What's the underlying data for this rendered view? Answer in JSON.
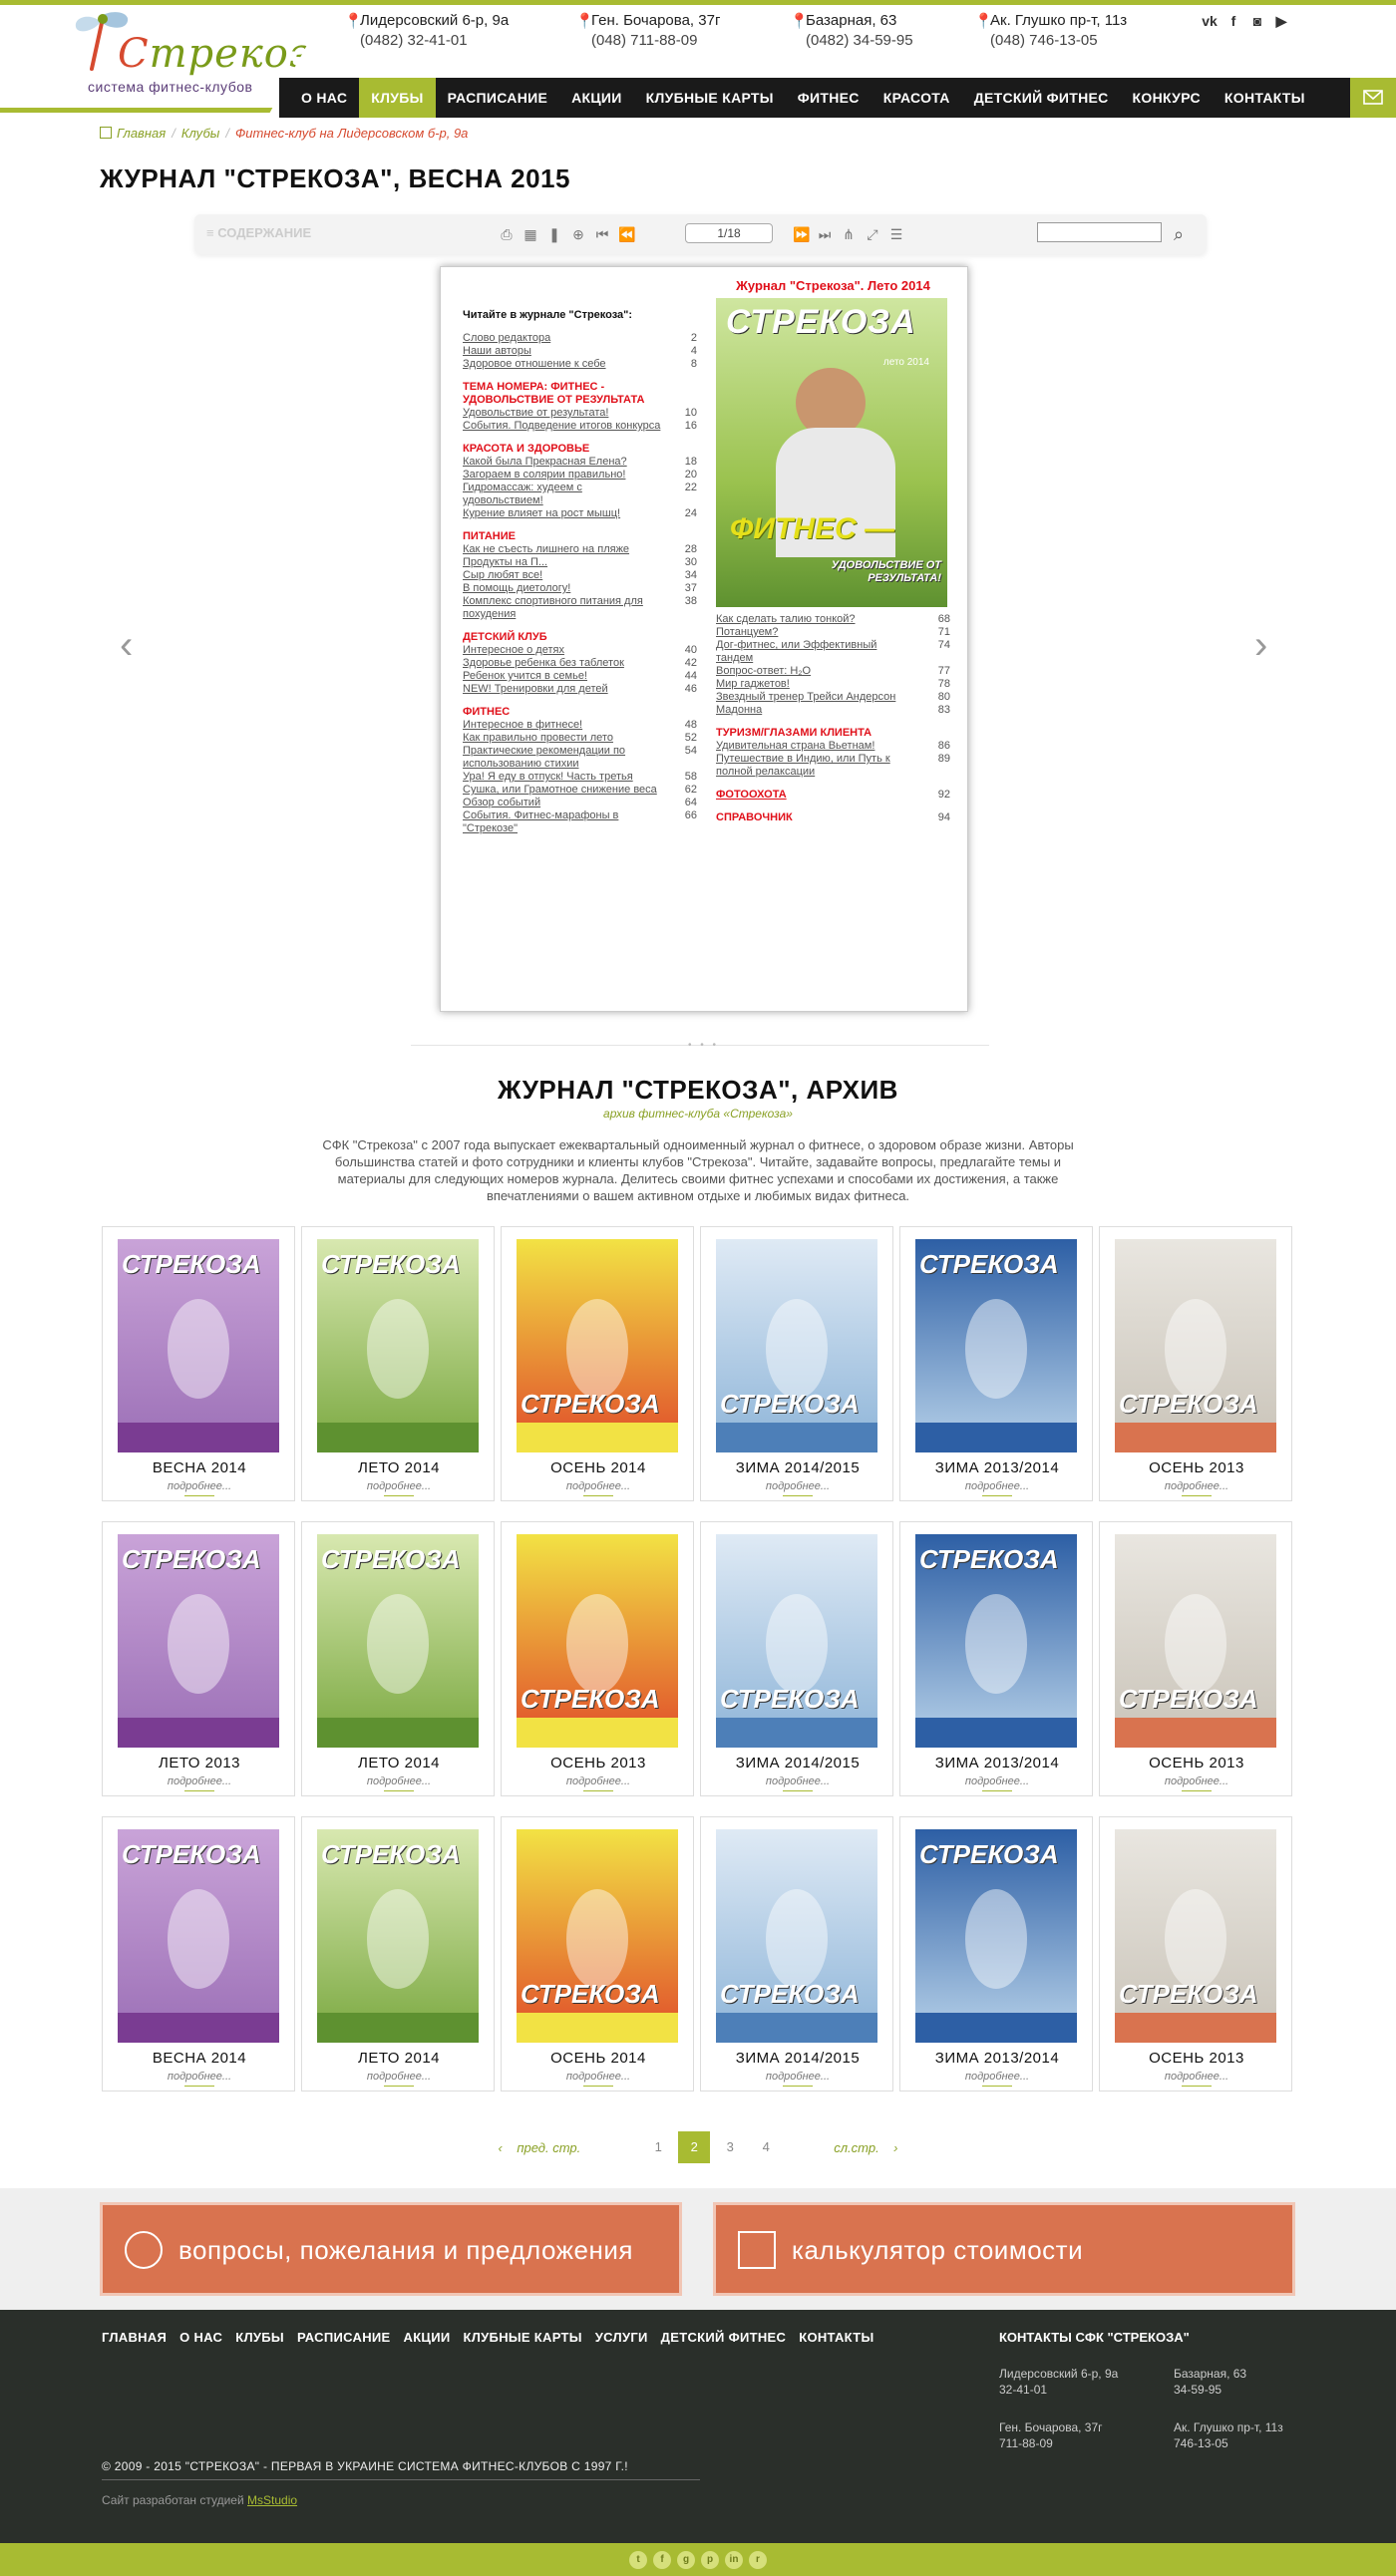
{
  "logo": {
    "brand": "Стрекоза",
    "subtitle": "система фитнес-клубов"
  },
  "contacts": [
    {
      "address": "Лидерсовский 6-р, 9а",
      "phone": "(0482) 32-41-01"
    },
    {
      "address": "Ген. Бочарова, 37г",
      "phone": "(048) 711-88-09"
    },
    {
      "address": "Базарная, 63",
      "phone": "(0482) 34-59-95"
    },
    {
      "address": "Ак. Глушко пр-т, 11з",
      "phone": "(048) 746-13-05"
    }
  ],
  "social_icons": [
    "vk-icon",
    "facebook-icon",
    "instagram-icon",
    "youtube-icon"
  ],
  "nav": [
    "О НАС",
    "КЛУБЫ",
    "РАСПИСАНИЕ",
    "АКЦИИ",
    "КЛУБНЫЕ КАРТЫ",
    "ФИТНЕС",
    "КРАСОТА",
    "ДЕТСКИЙ ФИТНЕС",
    "КОНКУРС",
    "КОНТАКТЫ"
  ],
  "nav_active": "КЛУБЫ",
  "breadcrumb": [
    "Главная",
    "Клубы",
    "Фитнес-клуб на Лидерсовском б-р, 9а"
  ],
  "page_title": "ЖУРНАЛ \"СТРЕКОЗА\", ВЕСНА 2015",
  "viewer": {
    "contents_label": "СОДЕРЖАНИЕ",
    "page_indicator": "1/18"
  },
  "magazine": {
    "heading": "Читайте в журнале \"Стрекоза\":",
    "right_title": "Журнал \"Стрекоза\". Лето 2014",
    "cover_brand": "СТРЕКОЗА",
    "cover_season": "лето 2014",
    "cover_word": "ФИТНЕС —",
    "cover_slogan": "УДОВОЛЬСТВИЕ ОТ РЕЗУЛЬТАТА!",
    "left": [
      {
        "t": "Слово редактора",
        "p": "2"
      },
      {
        "t": "Наши авторы",
        "p": "4"
      },
      {
        "t": "Здоровое отношение к себе",
        "p": "8"
      },
      {
        "sec": "ТЕМА НОМЕРА: ФИТНЕС - УДОВОЛЬСТВИЕ ОТ РЕЗУЛЬТАТА"
      },
      {
        "t": "Удовольствие от результата!",
        "p": "10"
      },
      {
        "t": "События. Подведение итогов конкурса",
        "p": "16"
      },
      {
        "sec": "КРАСОТА И ЗДОРОВЬЕ"
      },
      {
        "t": "Какой была Прекрасная Елена?",
        "p": "18"
      },
      {
        "t": "Загораем в солярии правильно!",
        "p": "20"
      },
      {
        "t": "Гидромассаж: худеем с удовольствием!",
        "p": "22"
      },
      {
        "t": "Курение влияет на рост мышц!",
        "p": "24"
      },
      {
        "sec": "ПИТАНИЕ"
      },
      {
        "t": "Как не съесть лишнего на пляже",
        "p": "28"
      },
      {
        "t": "Продукты на П...",
        "p": "30"
      },
      {
        "t": "Сыр любят все!",
        "p": "34"
      },
      {
        "t": "В помощь диетологу!",
        "p": "37"
      },
      {
        "t": "Комплекс спортивного питания для похудения",
        "p": "38"
      },
      {
        "sec": "ДЕТСКИЙ КЛУБ"
      },
      {
        "t": "Интересное о детях",
        "p": "40"
      },
      {
        "t": "Здоровье ребенка без таблеток",
        "p": "42"
      },
      {
        "t": "Ребенок учится в семье!",
        "p": "44"
      },
      {
        "t": "NEW! Тренировки для детей",
        "p": "46"
      },
      {
        "sec": "ФИТНЕС"
      },
      {
        "t": "Интересное в фитнесе!",
        "p": "48"
      },
      {
        "t": "Как правильно провести лето",
        "p": "52"
      },
      {
        "t": "Практические рекомендации по использованию стихии",
        "p": "54"
      },
      {
        "t": "Ура! Я еду в отпуск! Часть третья",
        "p": "58"
      },
      {
        "t": "Сушка, или Грамотное снижение веса",
        "p": "62"
      },
      {
        "t": "Обзор событий",
        "p": "64"
      },
      {
        "t": "События. Фитнес-марафоны в \"Стрекозе\"",
        "p": "66"
      }
    ],
    "right": [
      {
        "t": "Как сделать талию тонкой?",
        "p": "68"
      },
      {
        "t": "Потанцуем?",
        "p": "71"
      },
      {
        "t": "Дог-фитнес, или Эффективный тандем",
        "p": "74"
      },
      {
        "t": "Вопрос-ответ: H₂O",
        "p": "77"
      },
      {
        "t": "Мир гаджетов!",
        "p": "78"
      },
      {
        "t": "Звездный тренер Трейси Андерсон",
        "p": "80"
      },
      {
        "t": "Мадонна",
        "p": "83"
      },
      {
        "sec": "ТУРИЗМ/ГЛАЗАМИ КЛИЕНТА"
      },
      {
        "t": "Удивительная страна Вьетнам!",
        "p": "86"
      },
      {
        "t": "Путешествие в Индию, или Путь к полной релаксации",
        "p": "89"
      },
      {
        "sec": "ФОТООХОТА",
        "p": "92"
      },
      {
        "sec": "СПРАВОЧНИК",
        "p": "94"
      }
    ]
  },
  "archive": {
    "title": "ЖУРНАЛ \"СТРЕКОЗА\", АРХИВ",
    "subtitle": "архив фитнес-клуба «Стрекоза»",
    "description": "СФК \"Стрекоза\" с 2007 года выпускает ежеквартальный одноименный журнал о фитнесе, о здоровом образе жизни. Авторы большинства статей и фото сотрудники и клиенты клубов \"Стрекоза\". Читайте, задавайте вопросы, предлагайте темы и материалы для следующих номеров журнала. Делитесь своими фитнес успехами и способами их достижения, а также впечатлениями о вашем активном отдыхе и любимых видах фитнеса.",
    "more_label": "подробнее...",
    "rows": [
      [
        "ВЕСНА 2014",
        "ЛЕТО 2014",
        "ОСЕНЬ 2014",
        "ЗИМА 2014/2015",
        "ЗИМА 2013/2014",
        "ОСЕНЬ 2013"
      ],
      [
        "ЛЕТО 2013",
        "ЛЕТО 2014",
        "ОСЕНЬ 2013",
        "ЗИМА 2014/2015",
        "ЗИМА 2013/2014",
        "ОСЕНЬ 2013"
      ],
      [
        "ВЕСНА 2014",
        "ЛЕТО 2014",
        "ОСЕНЬ 2014",
        "ЗИМА 2014/2015",
        "ЗИМА 2013/2014",
        "ОСЕНЬ 2013"
      ]
    ]
  },
  "pagination": {
    "prev": "пред. стр.",
    "pages": [
      "1",
      "2",
      "3",
      "4"
    ],
    "current": "2",
    "next": "сл.стр."
  },
  "cta": {
    "feedback": "вопросы, пожелания и предложения",
    "calculator": "калькулятор стоимости"
  },
  "footer": {
    "nav": [
      "ГЛАВНАЯ",
      "О НАС",
      "КЛУБЫ",
      "РАСПИСАНИЕ",
      "АКЦИИ",
      "КЛУБНЫЕ КАРТЫ",
      "УСЛУГИ",
      "ДЕТСКИЙ ФИТНЕС",
      "КОНТАКТЫ"
    ],
    "contacts_title": "КОНТАКТЫ СФК \"СТРЕКОЗА\"",
    "addresses": [
      {
        "a": "Лидерсовский 6-р, 9а",
        "p": "32-41-01"
      },
      {
        "a": "Базарная, 63",
        "p": "34-59-95"
      },
      {
        "a": "Ген. Бочарова, 37г",
        "p": "711-88-09"
      },
      {
        "a": "Ак. Глушко пр-т, 11з",
        "p": "746-13-05"
      }
    ],
    "copyright": "© 2009 - 2015 \"СТРЕКОЗА\" - ПЕРВАЯ В УКРАИНЕ СИСТЕМА ФИТНЕС-КЛУБОВ С 1997 Г.!",
    "dev_prefix": "Сайт разработан студией",
    "dev_name": "MsStudio"
  },
  "bottom_icons": [
    "twitter-icon",
    "facebook-icon",
    "google-icon",
    "pinterest-icon",
    "linkedin-icon",
    "rss-icon"
  ]
}
